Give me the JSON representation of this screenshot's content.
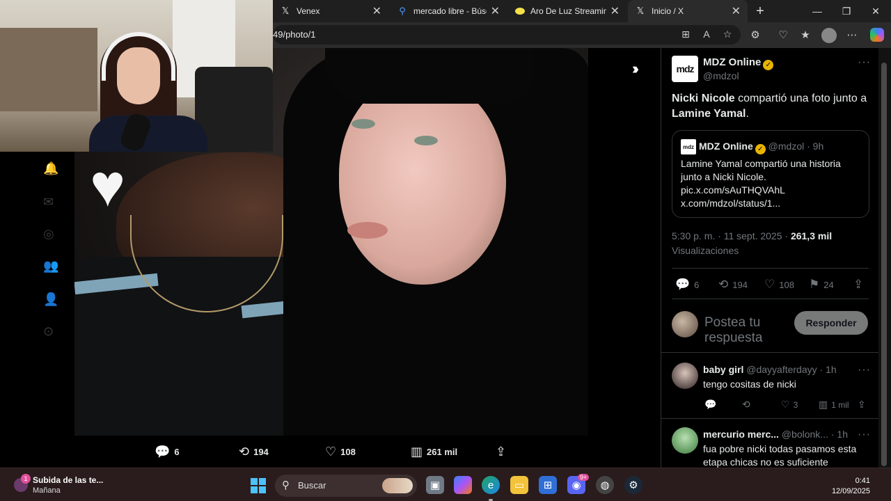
{
  "browser": {
    "tabs": [
      {
        "label": "Venex",
        "icon": "x-logo-icon"
      },
      {
        "label": "mercado libre - Búsqueda",
        "icon": "search-icon"
      },
      {
        "label": "Aro De Luz Streaming",
        "icon": "mercadolibre-icon"
      },
      {
        "label": "Inicio / X",
        "icon": "x-logo-icon",
        "active": true
      }
    ],
    "new_tab": "+",
    "url": "49/photo/1",
    "window": {
      "minimize": "—",
      "maximize": "❐",
      "close": "✕"
    }
  },
  "photo_actions": {
    "replies": "6",
    "reposts": "194",
    "likes": "108",
    "views": "261 mil"
  },
  "tweet": {
    "author_name": "MDZ Online",
    "author_handle": "@mdzol",
    "logo_text": "mdz",
    "text_part1": "Nicki Nicole",
    "text_part2": " compartió una foto junto a ",
    "text_part3": "Lamine Yamal",
    "text_part4": ".",
    "quote": {
      "author_name": "MDZ Online",
      "handle_time": "@mdzol · 9h",
      "text_line1": "Lamine Yamal compartió una historia junto a Nicki Nicole.",
      "text_line2": "pic.x.com/sAuTHQVAhL",
      "text_line3": "x.com/mdzol/status/1..."
    },
    "timestamp": "5:30 p. m. · 11 sept. 2025 · ",
    "views_count": "261,3 mil",
    "views_label": "Visualizaciones",
    "stats": {
      "replies": "6",
      "reposts": "194",
      "likes": "108",
      "bookmarks": "24"
    }
  },
  "reply_box": {
    "placeholder": "Postea tu respuesta",
    "button": "Responder"
  },
  "replies": [
    {
      "name": "baby girl",
      "handle_time": "@dayyafterdayy · 1h",
      "text": "tengo cositas de nicki",
      "likes": "3",
      "views": "1 mil"
    },
    {
      "name": "mercurio merc...",
      "handle_time": "@bolonk... · 1h",
      "text": "fua pobre nicki todas pasamos esta etapa chicas no es suficiente"
    }
  ],
  "taskbar": {
    "notification_title": "Subida de las te...",
    "notification_sub": "Mañana",
    "notification_badge": "1",
    "search_label": "Buscar",
    "discord_badge": "9+",
    "time": "0:41",
    "date": "12/09/2025"
  },
  "colors": {
    "x_background": "#000000",
    "accent_verified": "#e8b400",
    "muted_text": "#71767b",
    "taskbar": "#2a1c1c"
  }
}
